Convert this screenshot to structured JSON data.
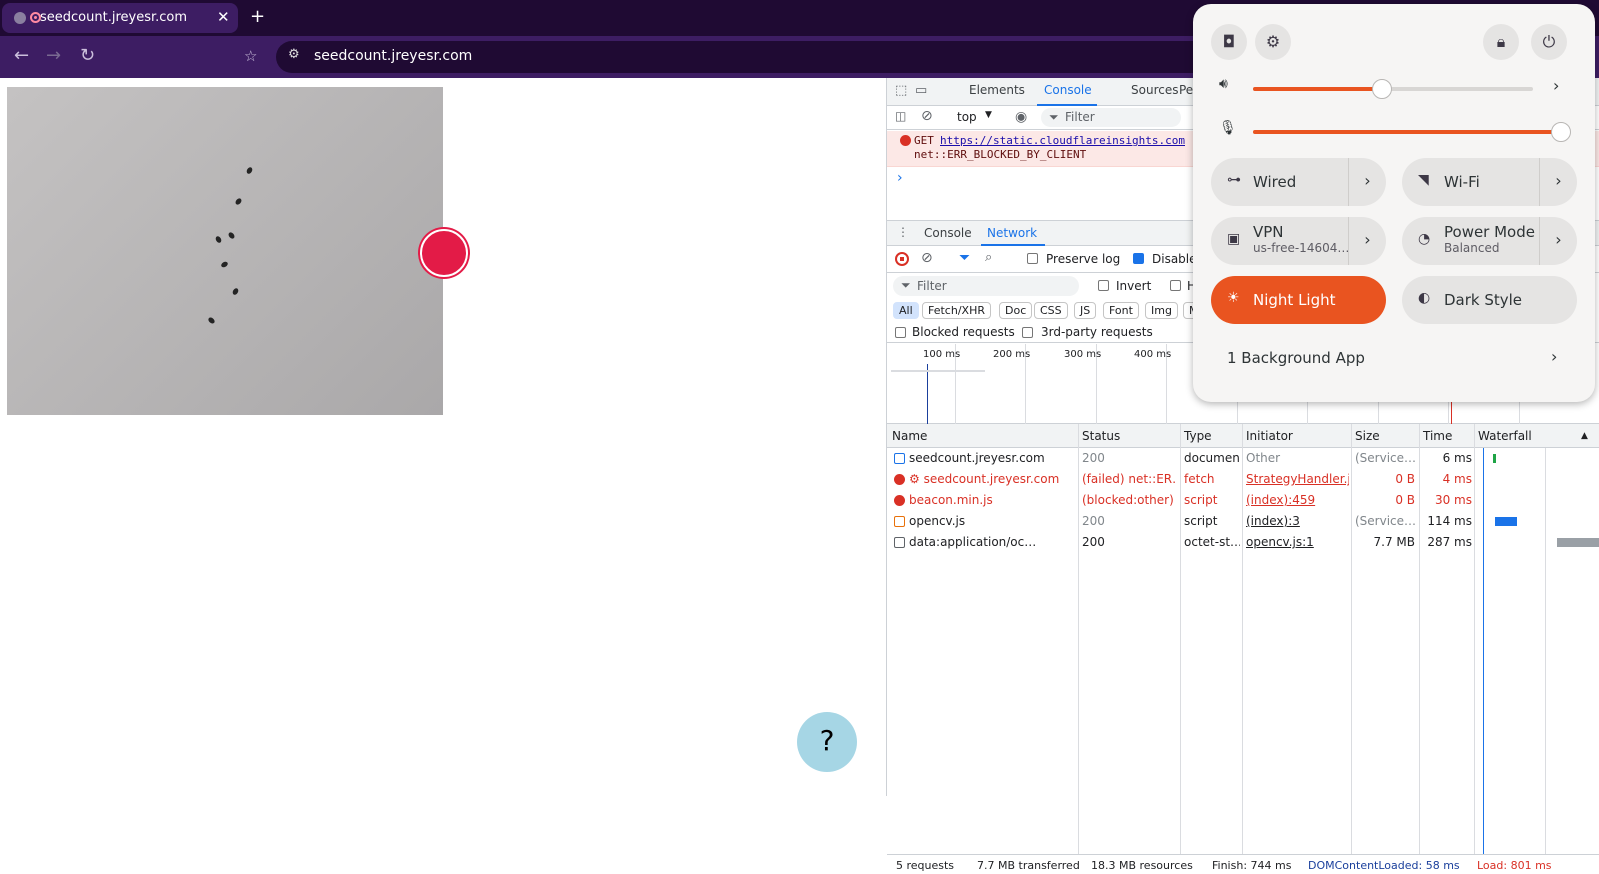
{
  "browser": {
    "tab_title": "seedcount.jreyesr.com",
    "tab_close": "✕",
    "new_tab": "+",
    "url": "seedcount.jreyesr.com"
  },
  "page": {
    "help_label": "?"
  },
  "devtools": {
    "tabs": [
      "Elements",
      "Console",
      "Sources",
      "Per"
    ],
    "context": "top",
    "filter_placeholder": "Filter",
    "console_error": {
      "method": "GET",
      "url": "https://static.cloudflareinsights.com/",
      "message": "net::ERR_BLOCKED_BY_CLIENT"
    },
    "prompt": "›",
    "drawer_tabs": [
      "Console",
      "Network"
    ],
    "network": {
      "preserve_log": "Preserve log",
      "disable_cache": "Disable",
      "filter_placeholder": "Filter",
      "invert": "Invert",
      "hide_partial": "H",
      "types": [
        "All",
        "Fetch/XHR",
        "Doc",
        "CSS",
        "JS",
        "Font",
        "Img",
        "Me"
      ],
      "blocked_requests": "Blocked requests",
      "third_party": "3rd-party requests",
      "timeline_ticks": [
        "100 ms",
        "200 ms",
        "300 ms",
        "400 ms"
      ],
      "columns": [
        "Name",
        "Status",
        "Type",
        "Initiator",
        "Size",
        "Time",
        "Waterfall"
      ],
      "rows": [
        {
          "name": "seedcount.jreyesr.com",
          "status": "200",
          "type": "document",
          "initiator": "Other",
          "size": "(Service…",
          "time": "6 ms",
          "state": "ok-doc"
        },
        {
          "name": "⚙ seedcount.jreyesr.com",
          "status": "(failed) net::ER…",
          "type": "fetch",
          "initiator": "StrategyHandler.js:",
          "size": "0 B",
          "time": "4 ms",
          "state": "error"
        },
        {
          "name": "beacon.min.js",
          "status": "(blocked:other)",
          "type": "script",
          "initiator": "(index):459",
          "size": "0 B",
          "time": "30 ms",
          "state": "error"
        },
        {
          "name": "opencv.js",
          "status": "200",
          "type": "script",
          "initiator": "(index):3",
          "size": "(Service…",
          "time": "114 ms",
          "state": "ok-script"
        },
        {
          "name": "data:application/oc…",
          "status": "200",
          "type": "octet-st…",
          "initiator": "opencv.js:1",
          "size": "7.7 MB",
          "time": "287 ms",
          "state": "ok-data"
        }
      ],
      "summary": {
        "requests": "5 requests",
        "transferred": "7.7 MB transferred",
        "resources": "18.3 MB resources",
        "finish": "Finish: 744 ms",
        "dom": "DOMContentLoaded: 58 ms",
        "load": "Load: 801 ms"
      }
    }
  },
  "quick_settings": {
    "volume_level": 0.46,
    "mic_level": 1.0,
    "tiles": [
      {
        "label": "Wired",
        "sub": "",
        "icon": "wired-network-icon",
        "on": false,
        "arrow": true
      },
      {
        "label": "Wi-Fi",
        "sub": "",
        "icon": "wifi-icon",
        "on": false,
        "arrow": true
      },
      {
        "label": "VPN",
        "sub": "us-free-14604…",
        "icon": "vpn-icon",
        "on": false,
        "arrow": true
      },
      {
        "label": "Power Mode",
        "sub": "Balanced",
        "icon": "power-mode-icon",
        "on": false,
        "arrow": true
      },
      {
        "label": "Night Light",
        "sub": "",
        "icon": "night-light-icon",
        "on": true,
        "arrow": false
      },
      {
        "label": "Dark Style",
        "sub": "",
        "icon": "dark-style-icon",
        "on": false,
        "arrow": false
      }
    ],
    "background_apps": "1 Background App",
    "accent": "#e95420"
  }
}
